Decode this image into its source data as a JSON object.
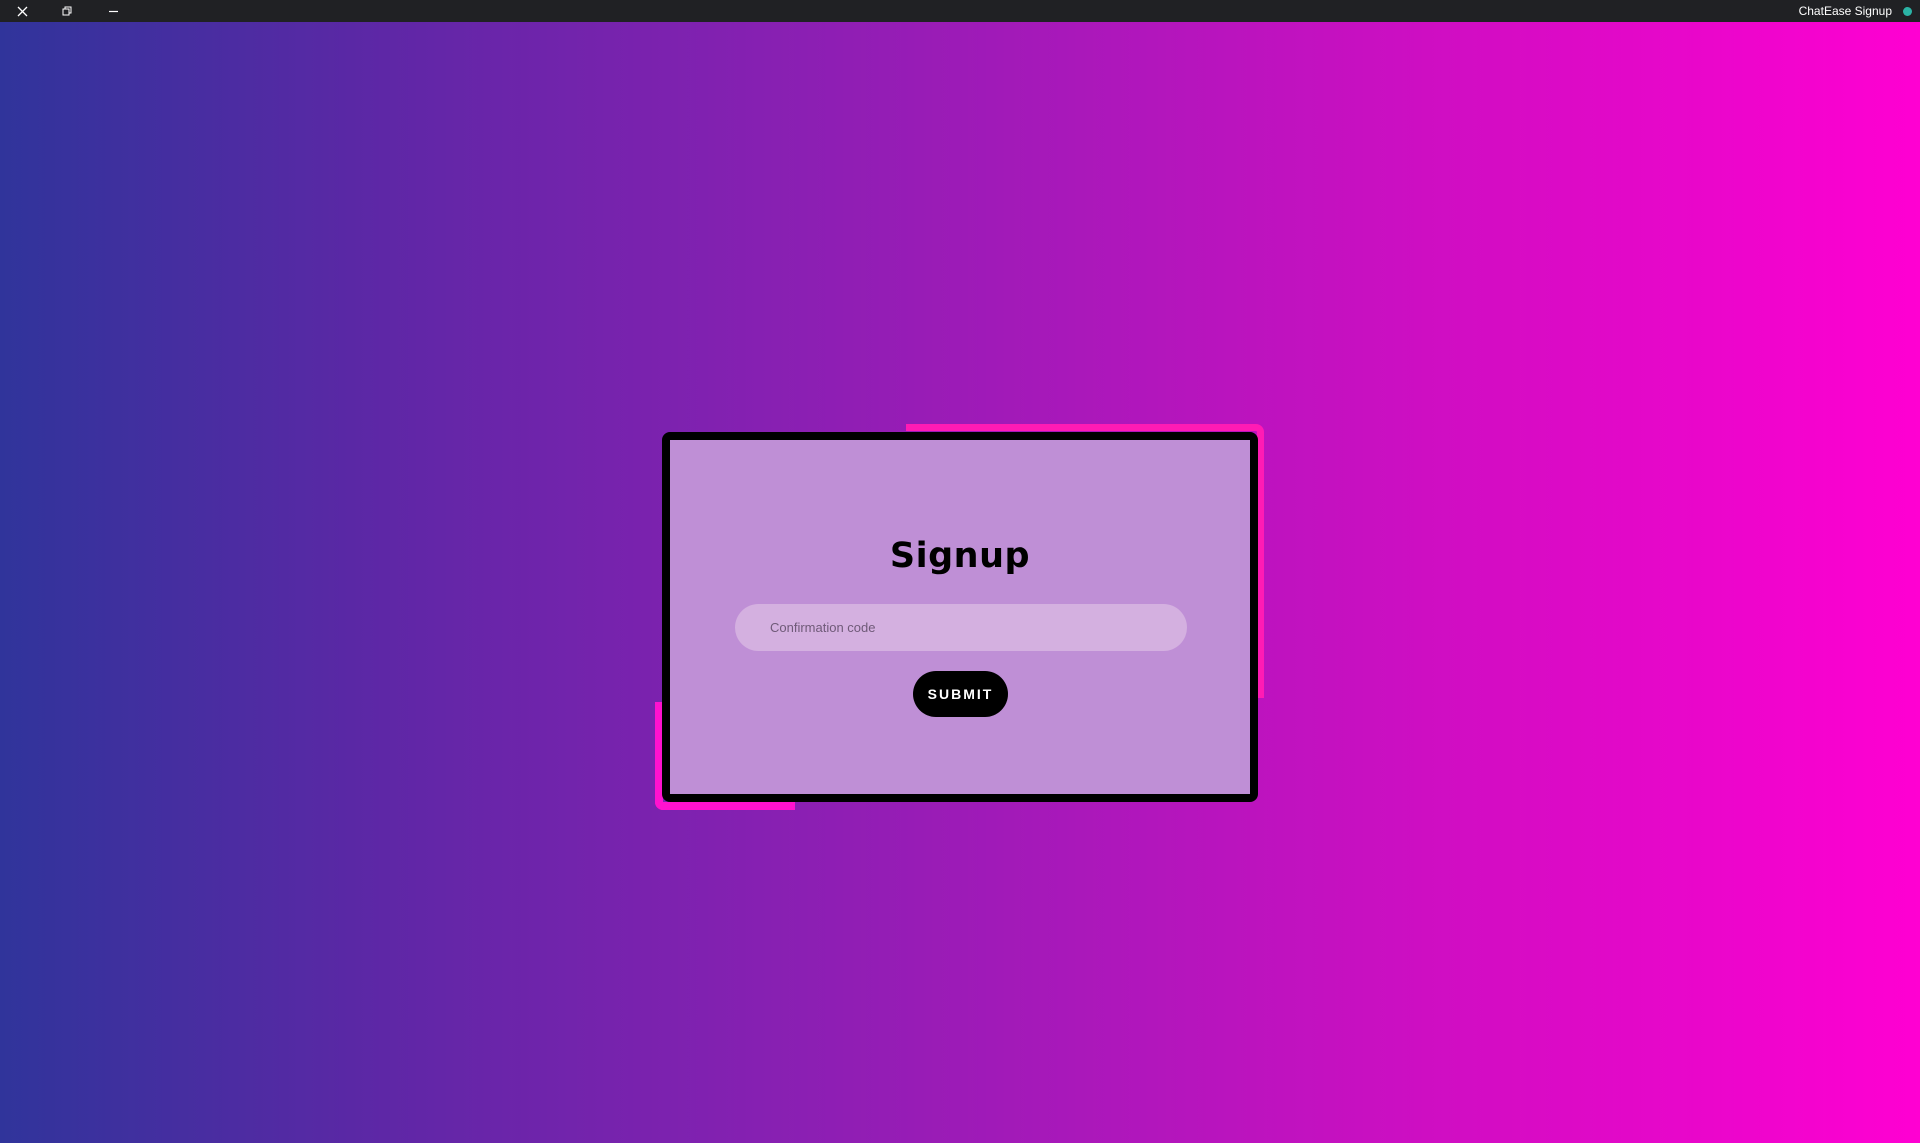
{
  "window": {
    "title": "ChatEase Signup",
    "controls": {
      "close_icon": "close-icon",
      "restore_icon": "restore-icon",
      "minimize_icon": "minimize-icon"
    },
    "status_color": "#2bb3a5"
  },
  "signup": {
    "title": "Signup",
    "confirmation_placeholder": "Confirmation code",
    "confirmation_value": "",
    "submit_label": "SUBMIT"
  },
  "colors": {
    "gradient_start": "#30349b",
    "gradient_end": "#ff00d2",
    "card_bg": "#bf8fd6",
    "accent": "#ff1bb4"
  }
}
